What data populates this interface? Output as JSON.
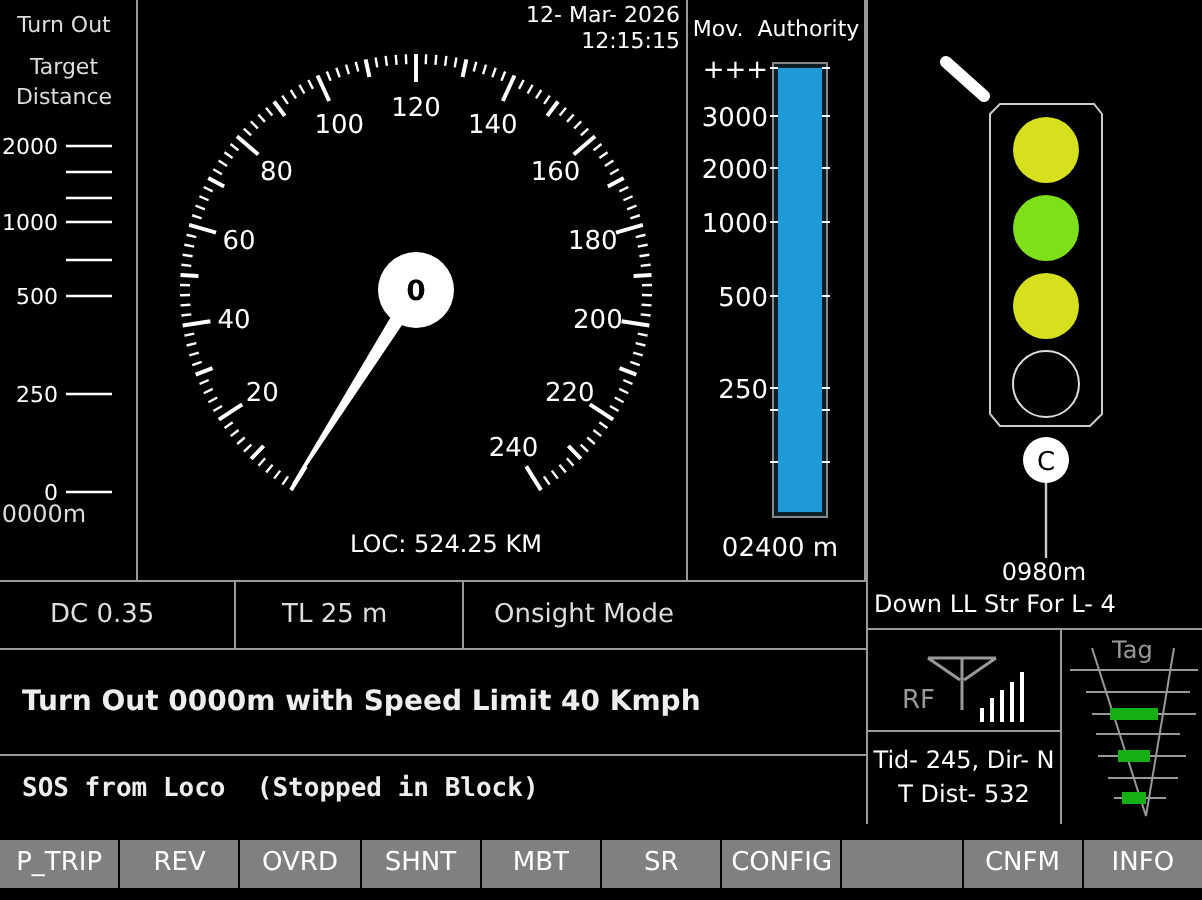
{
  "target_distance": {
    "title": "Turn Out",
    "subtitle": "Target Distance",
    "ticks": [
      {
        "kind": "major",
        "label": "2000"
      },
      {
        "kind": "minor"
      },
      {
        "kind": "minor"
      },
      {
        "kind": "major",
        "label": "1000"
      },
      {
        "kind": "minor"
      },
      {
        "kind": "major",
        "label": "500"
      },
      {
        "kind": "major",
        "label": "250"
      },
      {
        "kind": "major",
        "label": "0"
      }
    ],
    "reading": "0000m"
  },
  "speedometer": {
    "date": "12- Mar- 2026",
    "time": "12:15:15",
    "labels": [
      "20",
      "40",
      "60",
      "80",
      "100",
      "120",
      "140",
      "160",
      "180",
      "200",
      "220",
      "240"
    ],
    "speed": "0",
    "location": "LOC: 524.25 KM"
  },
  "movement_authority": {
    "title": "Mov.  Authority",
    "ticks": [
      {
        "kind": "major",
        "label": "+++"
      },
      {
        "kind": "major",
        "label": "3000"
      },
      {
        "kind": "major",
        "label": "2000"
      },
      {
        "kind": "major",
        "label": "1000"
      },
      {
        "kind": "major",
        "label": "500"
      },
      {
        "kind": "major",
        "label": "250"
      },
      {
        "kind": "minor"
      },
      {
        "kind": "minor"
      }
    ],
    "level": 1,
    "reading": "02400 m"
  },
  "signal": {
    "lamps": [
      {
        "lit": true,
        "color": "#d6e01f"
      },
      {
        "lit": true,
        "color": "#7ee01a"
      },
      {
        "lit": true,
        "color": "#d6e01f"
      },
      {
        "lit": false
      }
    ],
    "marker": "C",
    "distance": "0980m",
    "description": "Down LL Str For L- 4"
  },
  "status": [
    "DC 0.35",
    "TL 25 m",
    "Onsight Mode"
  ],
  "message": "Turn Out 0000m with Speed Limit 40 Kmph",
  "alert": "SOS from Loco  (Stopped in Block)",
  "radio": {
    "label": "RF"
  },
  "train_info": [
    "Tid- 245, Dir- N",
    "T Dist- 532"
  ],
  "tag": {
    "title": "Tag"
  },
  "buttons": [
    {
      "kind": "label",
      "label": "P_TRIP"
    },
    {
      "kind": "label",
      "label": "REV"
    },
    {
      "kind": "label",
      "label": "OVRD"
    },
    {
      "kind": "label",
      "label": "SHNT"
    },
    {
      "kind": "label",
      "label": "MBT"
    },
    {
      "kind": "label",
      "label": "SR"
    },
    {
      "kind": "label",
      "label": "CONFIG"
    },
    {
      "kind": "blank"
    },
    {
      "kind": "label",
      "label": "CNFM"
    },
    {
      "kind": "label",
      "label": "INFO"
    }
  ]
}
